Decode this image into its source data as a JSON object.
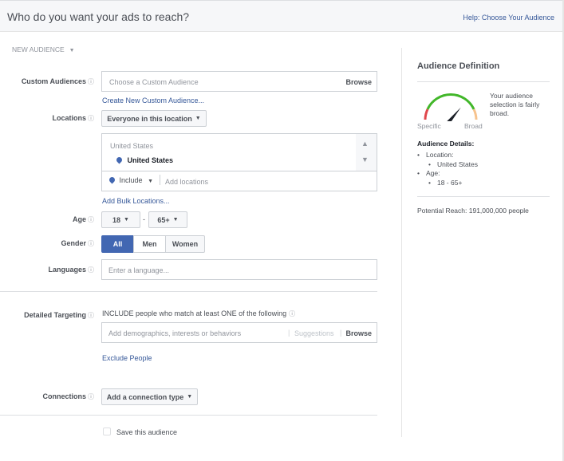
{
  "header": {
    "title": "Who do you want your ads to reach?",
    "help_link": "Help: Choose Your Audience"
  },
  "audience_selector": {
    "label": "NEW AUDIENCE",
    "icon": "caret-down-icon"
  },
  "form": {
    "custom_audiences": {
      "label": "Custom Audiences",
      "placeholder": "Choose a Custom Audience",
      "browse": "Browse",
      "create_link": "Create New Custom Audience..."
    },
    "locations": {
      "label": "Locations",
      "dropdown": "Everyone in this location",
      "group_header": "United States",
      "selected": "United States",
      "include": "Include",
      "placeholder": "Add locations",
      "bulk_link": "Add Bulk Locations..."
    },
    "age": {
      "label": "Age",
      "min": "18",
      "separator": "-",
      "max": "65+"
    },
    "gender": {
      "label": "Gender",
      "options": [
        "All",
        "Men",
        "Women"
      ],
      "selected": "All"
    },
    "languages": {
      "label": "Languages",
      "placeholder": "Enter a language..."
    },
    "detailed_targeting": {
      "label": "Detailed Targeting",
      "description": "INCLUDE people who match at least ONE of the following",
      "placeholder": "Add demographics, interests or behaviors",
      "suggestions": "Suggestions",
      "browse": "Browse",
      "exclude_link": "Exclude People"
    },
    "connections": {
      "label": "Connections",
      "dropdown": "Add a connection type"
    },
    "save_audience": {
      "label": "Save this audience",
      "checked": false
    }
  },
  "audience_definition": {
    "title": "Audience Definition",
    "gauge": {
      "left_label": "Specific",
      "right_label": "Broad",
      "level": 0.72
    },
    "summary": "Your audience selection is fairly broad.",
    "details_title": "Audience Details:",
    "details": [
      {
        "key": "Location:",
        "values": [
          "United States"
        ]
      },
      {
        "key": "Age:",
        "values": [
          "18 - 65+"
        ]
      }
    ],
    "potential_reach": "Potential Reach: 191,000,000 people"
  },
  "colors": {
    "accent": "#4267b2",
    "link": "#365899",
    "gauge_green": "#42b72a",
    "gauge_red": "#e0474c",
    "gauge_orange": "#f7c38d"
  }
}
